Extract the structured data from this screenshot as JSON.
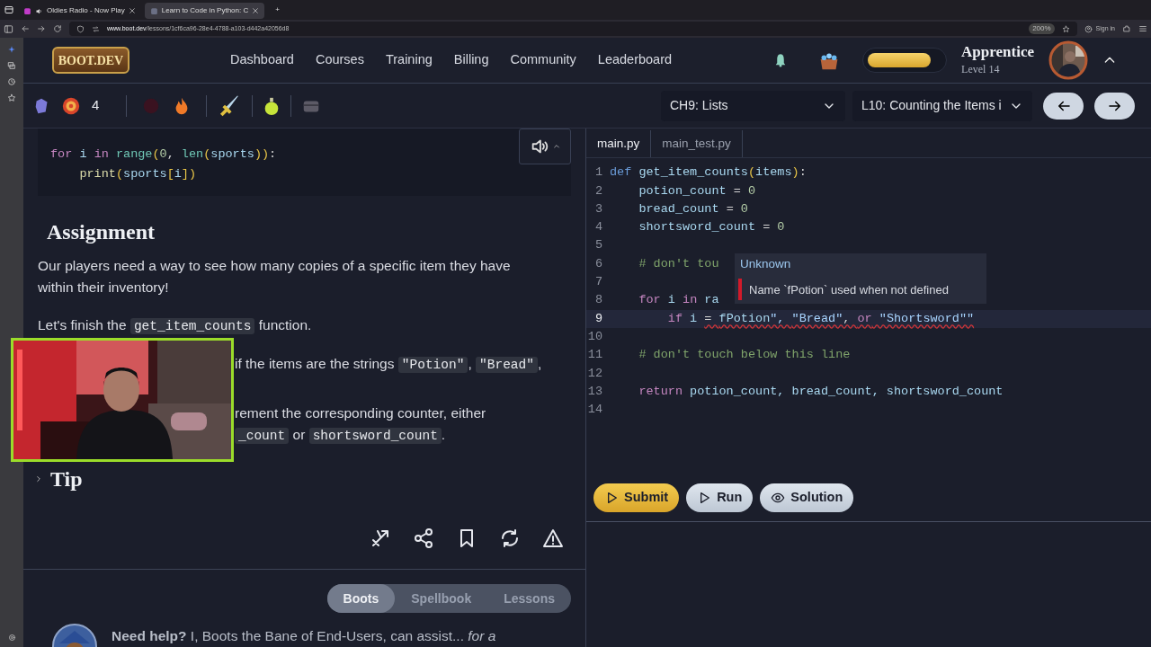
{
  "browser": {
    "tabs": [
      {
        "title": "Oldies Radio - Now Play",
        "selected": false,
        "audio": true
      },
      {
        "title": "Learn to Code in Python: C",
        "selected": true,
        "audio": false
      }
    ],
    "new_tab": "+",
    "url_host": "www.boot.dev",
    "url_path": "/lessons/1cf6ca96-28e4-4788-a103-d442a42056d8",
    "zoom": "200%",
    "sign_in": "Sign in"
  },
  "header": {
    "logo": "BOOT.DEV",
    "nav": [
      "Dashboard",
      "Courses",
      "Training",
      "Billing",
      "Community",
      "Leaderboard"
    ],
    "xp": {
      "level": 0.85
    },
    "rank": "Apprentice",
    "level_label": "Level 14"
  },
  "stats": {
    "count": "4"
  },
  "course": {
    "chapter": "CH9: Lists",
    "lesson": "L10: Counting the Items i"
  },
  "lesson": {
    "code_sample": [
      {
        "tokens": [
          {
            "text": "for",
            "kind": "keyword"
          },
          {
            "text": " i ",
            "kind": "name"
          },
          {
            "text": "in",
            "kind": "keyword"
          },
          {
            "text": " range",
            "kind": "builtin"
          },
          {
            "text": "(",
            "kind": "paren"
          },
          {
            "text": "0",
            "kind": "number"
          },
          {
            "text": ", ",
            "kind": "punct"
          },
          {
            "text": "len",
            "kind": "builtin"
          },
          {
            "text": "(",
            "kind": "paren"
          },
          {
            "text": "sports",
            "kind": "name"
          },
          {
            "text": "))",
            "kind": "paren"
          },
          {
            "text": ":",
            "kind": "punct"
          }
        ]
      },
      {
        "tokens": [
          {
            "text": "    print",
            "kind": "func"
          },
          {
            "text": "(",
            "kind": "paren"
          },
          {
            "text": "sports",
            "kind": "name"
          },
          {
            "text": "[",
            "kind": "paren"
          },
          {
            "text": "i",
            "kind": "name"
          },
          {
            "text": "])",
            "kind": "paren"
          }
        ]
      }
    ],
    "heading": "Assignment",
    "paragraphs": [
      {
        "lines": [
          [
            {
              "text": "Our players need a way to see how many copies of a specific item they have within their inventory!",
              "code": false
            }
          ]
        ]
      },
      {
        "lines": [
          [
            {
              "text": "Let's finish the ",
              "code": false
            },
            {
              "text": "get_item_counts",
              "code": true
            },
            {
              "text": " function.",
              "code": false
            }
          ]
        ]
      },
      {
        "covered": true,
        "lines": [
          [
            {
              "text": "if the items are the strings ",
              "code": false
            },
            {
              "text": "\"Potion\"",
              "code": true
            },
            {
              "text": ", ",
              "code": false
            },
            {
              "text": "\"Bread\"",
              "code": true
            },
            {
              "text": ",",
              "code": false
            }
          ]
        ]
      },
      {
        "covered": true,
        "lines": [
          [
            {
              "text": "rement the corresponding counter, either",
              "code": false
            }
          ],
          [
            {
              "text": "_count",
              "code": true
            },
            {
              "text": " or ",
              "code": false
            },
            {
              "text": "shortsword_count",
              "code": true
            },
            {
              "text": ".",
              "code": false
            }
          ]
        ]
      }
    ],
    "tip": {
      "label": "Tip",
      "expanded": false
    },
    "help_tabs": [
      {
        "label": "Boots",
        "selected": true
      },
      {
        "label": "Spellbook",
        "selected": false
      },
      {
        "label": "Lessons",
        "selected": false
      }
    ],
    "help_text": "**Need help?** I, Boots the Bane of End-Users, can assist... *for a*"
  },
  "editor": {
    "tabs": [
      {
        "label": "main.py",
        "selected": true
      },
      {
        "label": "main_test.py",
        "selected": false
      }
    ],
    "lines": [
      {
        "number": "1",
        "current": false,
        "tokens": [
          {
            "text": "def",
            "kind": "storage"
          },
          {
            "text": " get_item_counts",
            "kind": "name"
          },
          {
            "text": "(",
            "kind": "paren"
          },
          {
            "text": "items",
            "kind": "name"
          },
          {
            "text": ")",
            "kind": "paren"
          },
          {
            "text": ":",
            "kind": "punct"
          }
        ]
      },
      {
        "number": "2",
        "current": false,
        "tokens": [
          {
            "text": "    potion_count",
            "kind": "name"
          },
          {
            "text": " = ",
            "kind": "punct"
          },
          {
            "text": "0",
            "kind": "number"
          }
        ]
      },
      {
        "number": "3",
        "current": false,
        "tokens": [
          {
            "text": "    bread_count",
            "kind": "name"
          },
          {
            "text": " = ",
            "kind": "punct"
          },
          {
            "text": "0",
            "kind": "number"
          }
        ]
      },
      {
        "number": "4",
        "current": false,
        "tokens": [
          {
            "text": "    shortsword_count",
            "kind": "name"
          },
          {
            "text": " = ",
            "kind": "punct"
          },
          {
            "text": "0",
            "kind": "number"
          }
        ]
      },
      {
        "number": "5",
        "current": false
      },
      {
        "number": "6",
        "current": false,
        "tokens": [
          {
            "text": "    # don't tou",
            "kind": "comment"
          }
        ]
      },
      {
        "number": "7",
        "current": false
      },
      {
        "number": "8",
        "current": false,
        "tokens": [
          {
            "text": "    for",
            "kind": "keyword"
          },
          {
            "text": " i ",
            "kind": "name"
          },
          {
            "text": "in",
            "kind": "keyword"
          },
          {
            "text": " ra",
            "kind": "name"
          }
        ]
      },
      {
        "number": "9",
        "current": true,
        "tokens": [
          {
            "text": "        if",
            "kind": "keyword"
          },
          {
            "text": " i ",
            "kind": "name"
          },
          {
            "text": "= ",
            "kind": "punct",
            "error": true
          },
          {
            "text": "fPotion",
            "kind": "name",
            "error": true
          },
          {
            "text": "\", ",
            "kind": "string",
            "error": true
          },
          {
            "text": "\"Bread\"",
            "kind": "string",
            "error": true
          },
          {
            "text": ", ",
            "kind": "punct",
            "error": true
          },
          {
            "text": "or",
            "kind": "keyword",
            "error": true
          },
          {
            "text": " \"Shortsword\"\"",
            "kind": "string",
            "error": true
          }
        ]
      },
      {
        "number": "10",
        "current": false
      },
      {
        "number": "11",
        "current": false,
        "tokens": [
          {
            "text": "    # don't touch below this line",
            "kind": "comment"
          }
        ]
      },
      {
        "number": "12",
        "current": false
      },
      {
        "number": "13",
        "current": false,
        "tokens": [
          {
            "text": "    return",
            "kind": "keyword"
          },
          {
            "text": " potion_count, bread_count, shortsword_count",
            "kind": "name"
          }
        ]
      },
      {
        "number": "14",
        "current": false
      }
    ],
    "tooltip": {
      "title": "Unknown",
      "message": "Name `fPotion` used when not defined"
    },
    "buttons": [
      {
        "label": "Submit",
        "kind": "submit"
      },
      {
        "label": "Run",
        "kind": "run"
      },
      {
        "label": "Solution",
        "kind": "solution"
      }
    ]
  }
}
